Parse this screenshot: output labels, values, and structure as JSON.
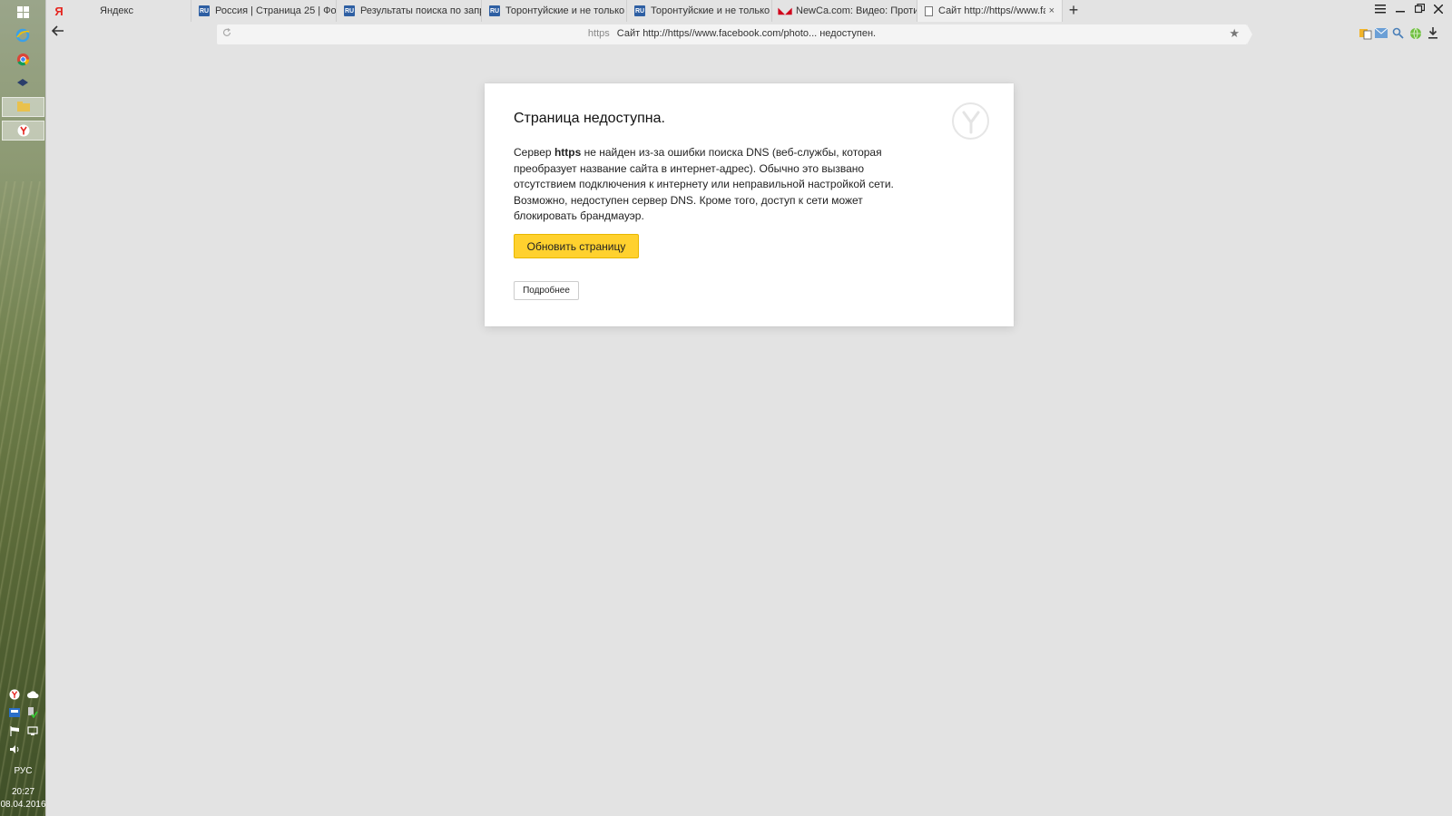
{
  "taskbar": {
    "language": "РУС",
    "time": "20:27",
    "date": "08.04.2016"
  },
  "tabs": [
    {
      "label": "Яндекс",
      "favicon": "yandex-icon"
    },
    {
      "label": "Россия | Страница 25 | Форум",
      "favicon": "forum-icon"
    },
    {
      "label": "Результаты поиска по запросу",
      "favicon": "forum-icon"
    },
    {
      "label": "Торонтуйские и не только за",
      "favicon": "forum-icon"
    },
    {
      "label": "Торонтуйские и не только за",
      "favicon": "forum-icon"
    },
    {
      "label": "NewCa.com: Видео: Противо",
      "favicon": "newsru-icon"
    },
    {
      "label": "Сайт http://https//www.fa",
      "favicon": "document-icon",
      "active": true,
      "close": "×"
    }
  ],
  "new_tab": "+",
  "address": {
    "protocol": "https",
    "text": "Сайт http://https//www.facebook.com/photo... недоступен."
  },
  "error": {
    "title": "Страница недоступна.",
    "msg_prefix": "Сервер ",
    "msg_host": "https",
    "msg_rest": " не найден из-за ошибки поиска DNS (веб-службы, которая преобразует название сайта в интернет-адрес). Обычно это вызвано отсутствием подключения к интернету или неправильной настройкой сети. Возможно, недоступен сервер DNS. Кроме того, доступ к сети может блокировать брандмауэр.",
    "reload_button": "Обновить страницу",
    "more_button": "Подробнее"
  },
  "colors": {
    "accent_button": "#ffd12e",
    "page_background": "#e3e3e3"
  }
}
